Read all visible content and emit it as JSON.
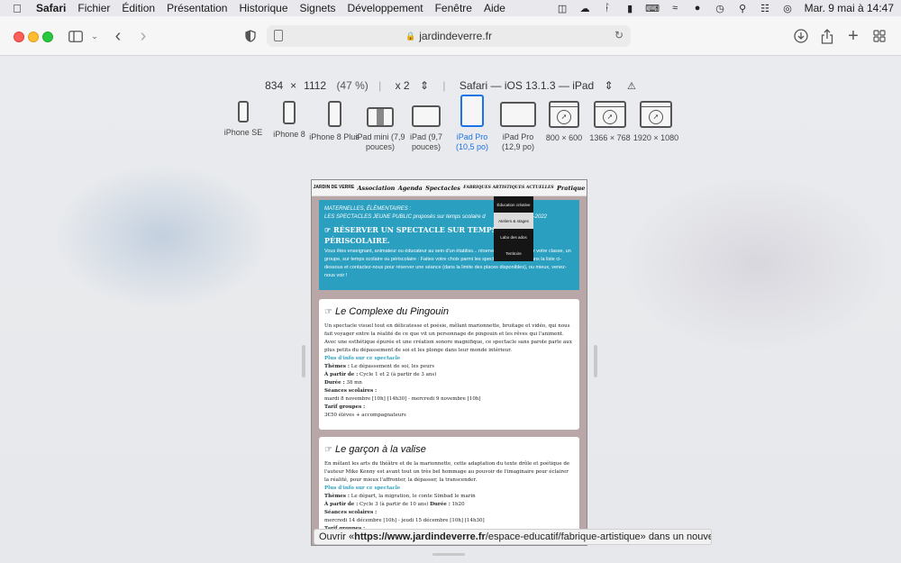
{
  "menubar": {
    "app": "Safari",
    "items": [
      "Fichier",
      "Édition",
      "Présentation",
      "Historique",
      "Signets",
      "Développement",
      "Fenêtre",
      "Aide"
    ],
    "clock": "Mar. 9 mai à 14:47"
  },
  "toolbar": {
    "address": "jardindeverre.fr"
  },
  "rdm": {
    "width": "834",
    "times": "×",
    "height": "1112",
    "zoom": "(47 %)",
    "scale": "x 2",
    "user_agent": "Safari — iOS 13.1.3 — iPad",
    "devices": [
      {
        "label": "iPhone SE"
      },
      {
        "label": "iPhone 8"
      },
      {
        "label": "iPhone 8 Plus"
      },
      {
        "label": "iPad mini (7,9 pouces)"
      },
      {
        "label": "iPad (9,7 pouces)"
      },
      {
        "label": "iPad Pro (10,5 po)",
        "active": true
      },
      {
        "label": "iPad Pro (12,9 po)"
      },
      {
        "label": "800 × 600"
      },
      {
        "label": "1366 × 768"
      },
      {
        "label": "1920 × 1080"
      }
    ]
  },
  "site": {
    "nav": {
      "logo": "JARDIN DE VERRE",
      "links": [
        "Association",
        "Agenda",
        "Spectacles",
        "FABRIQUES ARTISTIQUES ACTUELLES",
        "Pratique"
      ]
    },
    "dropdown": [
      "Éducation créative",
      "Ateliers & stages",
      "Labo des ados",
      "Territoire"
    ],
    "hero": {
      "sub1": "MATERNELLES, ÉLÉMENTAIRES :",
      "sub2": "LES SPECTACLES JEUNE PUBLIC proposés sur temps scolaire d",
      "sub2b": "2021-2022",
      "title": "RÉSERVER UN SPECTACLE SUR TEMPS SCO... PÉRISCOLAIRE.",
      "body": "Vous êtes enseignant, animateur ou éducateur au sein d'un établiss... réserver une séance pour votre classe, un groupe, sur temps scolaire ou périscolaire : Faites votre choix parmi les spectacles proposés dans la liste ci-dessous et contactez-nous pour réserver une séance (dans la limite des places disponibles), ou mieux, venez-nous voir !"
    },
    "cards": [
      {
        "title": "Le Complexe du Pingouin",
        "text": "Un spectacle visuel tout en délicatesse et poésie, mêlant marionnette, bruitage et vidéo, qui nous fait voyager entre la réalité de ce que vit un personnage de pingouin et les rêves qui l'animent. Avec une esthétique épurée et une création sonore magnifique, ce spectacle sans parole parle aux plus petits du dépassement de soi et les plonge dans leur monde intérieur.",
        "link": "Plus d'info sur ce spectacle",
        "themes_label": "Thèmes :",
        "themes": "Le dépassement de soi, les peurs",
        "age_label": "À partir de :",
        "age": "Cycle 1 et 2 (à partir de 3 ans)",
        "duree_label": "Durée :",
        "duree": "38 mn",
        "seances_label": "Séances scolaires :",
        "seances": "mardi 8 novembre [10h] [14h30] - mercredi 9 novembre [10h]",
        "tarif_label": "Tarif groupes :",
        "tarif": "3€50 élèves + accompagnateurs"
      },
      {
        "title": "Le garçon à la valise",
        "text": "En mêlant les arts du théâtre et de la marionnette, cette adaptation du texte drôle et poétique de l'auteur Mike Kenny est avant tout un très bel hommage au pouvoir de l'imaginaire pour éclairer la réalité, pour mieux l'affronter, la dépasser, la transcender.",
        "link": "Plus d'info sur ce spectacle",
        "themes_label": "Thèmes :",
        "themes": "Le départ, la migration, le conte Simbad le marin",
        "age_label": "À partir de :",
        "age": "Cycle 3 (à partir de 10 ans)",
        "duree_label": "Durée :",
        "duree": "1h20",
        "seances_label": "Séances scolaires :",
        "seances": "mercredi 14 décembre [10h] - jeudi 15 décembre [10h] [14h30]",
        "tarif_label": "Tarif groupes :"
      }
    ]
  },
  "statusbar": {
    "prefix": "Ouvrir « ",
    "url_bold": "https://www.jardindeverre.fr",
    "url_rest": "/espace-educatif/fabrique-artistique",
    "suffix": " » dans un nouvel onglet"
  }
}
